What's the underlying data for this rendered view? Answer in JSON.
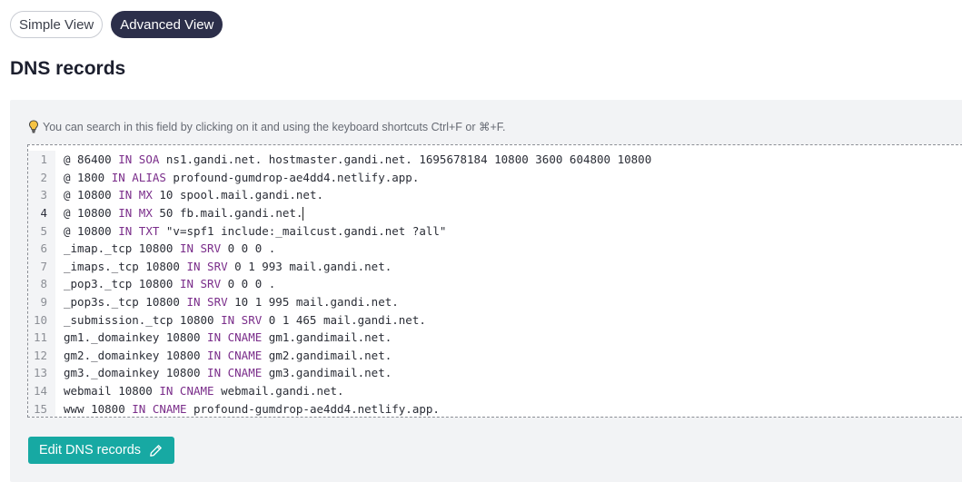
{
  "view_toggle": {
    "simple_label": "Simple View",
    "advanced_label": "Advanced View",
    "active": "advanced"
  },
  "page_title": "DNS records",
  "hint": {
    "icon": "lightbulb-icon",
    "text": "You can search in this field by clicking on it and using the keyboard shortcuts Ctrl+F or ⌘+F."
  },
  "editor": {
    "current_line": 4,
    "lines": [
      {
        "num": "1",
        "parts": [
          [
            "@ 86400 ",
            "t"
          ],
          [
            "IN SOA",
            "k"
          ],
          [
            " ns1.gandi.net. hostmaster.gandi.net. 1695678184 10800 3600 604800 10800",
            "t"
          ]
        ]
      },
      {
        "num": "2",
        "parts": [
          [
            "@ 1800 ",
            "t"
          ],
          [
            "IN ALIAS",
            "k"
          ],
          [
            " profound-gumdrop-ae4dd4.netlify.app.",
            "t"
          ]
        ]
      },
      {
        "num": "3",
        "parts": [
          [
            "@ 10800 ",
            "t"
          ],
          [
            "IN MX",
            "k"
          ],
          [
            " 10 spool.mail.gandi.net.",
            "t"
          ]
        ]
      },
      {
        "num": "4",
        "parts": [
          [
            "@ 10800 ",
            "t"
          ],
          [
            "IN MX",
            "k"
          ],
          [
            " 50 fb.mail.gandi.net.",
            "t"
          ]
        ]
      },
      {
        "num": "5",
        "parts": [
          [
            "@ 10800 ",
            "t"
          ],
          [
            "IN TXT",
            "k"
          ],
          [
            " \"v=spf1 include:_mailcust.gandi.net ?all\"",
            "t"
          ]
        ]
      },
      {
        "num": "6",
        "parts": [
          [
            "_imap._tcp 10800 ",
            "t"
          ],
          [
            "IN SRV",
            "k"
          ],
          [
            " 0 0 0 .",
            "t"
          ]
        ]
      },
      {
        "num": "7",
        "parts": [
          [
            "_imaps._tcp 10800 ",
            "t"
          ],
          [
            "IN SRV",
            "k"
          ],
          [
            " 0 1 993 mail.gandi.net.",
            "t"
          ]
        ]
      },
      {
        "num": "8",
        "parts": [
          [
            "_pop3._tcp 10800 ",
            "t"
          ],
          [
            "IN SRV",
            "k"
          ],
          [
            " 0 0 0 .",
            "t"
          ]
        ]
      },
      {
        "num": "9",
        "parts": [
          [
            "_pop3s._tcp 10800 ",
            "t"
          ],
          [
            "IN SRV",
            "k"
          ],
          [
            " 10 1 995 mail.gandi.net.",
            "t"
          ]
        ]
      },
      {
        "num": "10",
        "parts": [
          [
            "_submission._tcp 10800 ",
            "t"
          ],
          [
            "IN SRV",
            "k"
          ],
          [
            " 0 1 465 mail.gandi.net.",
            "t"
          ]
        ]
      },
      {
        "num": "11",
        "parts": [
          [
            "gm1._domainkey 10800 ",
            "t"
          ],
          [
            "IN CNAME",
            "k"
          ],
          [
            " gm1.gandimail.net.",
            "t"
          ]
        ]
      },
      {
        "num": "12",
        "parts": [
          [
            "gm2._domainkey 10800 ",
            "t"
          ],
          [
            "IN CNAME",
            "k"
          ],
          [
            " gm2.gandimail.net.",
            "t"
          ]
        ]
      },
      {
        "num": "13",
        "parts": [
          [
            "gm3._domainkey 10800 ",
            "t"
          ],
          [
            "IN CNAME",
            "k"
          ],
          [
            " gm3.gandimail.net.",
            "t"
          ]
        ]
      },
      {
        "num": "14",
        "parts": [
          [
            "webmail 10800 ",
            "t"
          ],
          [
            "IN CNAME",
            "k"
          ],
          [
            " webmail.gandi.net.",
            "t"
          ]
        ]
      },
      {
        "num": "15",
        "parts": [
          [
            "www 10800 ",
            "t"
          ],
          [
            "IN CNAME",
            "k"
          ],
          [
            " profound-gumdrop-ae4dd4.netlify.app.",
            "t"
          ]
        ]
      }
    ]
  },
  "edit_button": {
    "label": "Edit DNS records",
    "icon": "pencil-icon"
  },
  "colors": {
    "keyword": "#7a2d8a",
    "accent": "#17a9a3",
    "active_pill": "#2c2f4a"
  }
}
